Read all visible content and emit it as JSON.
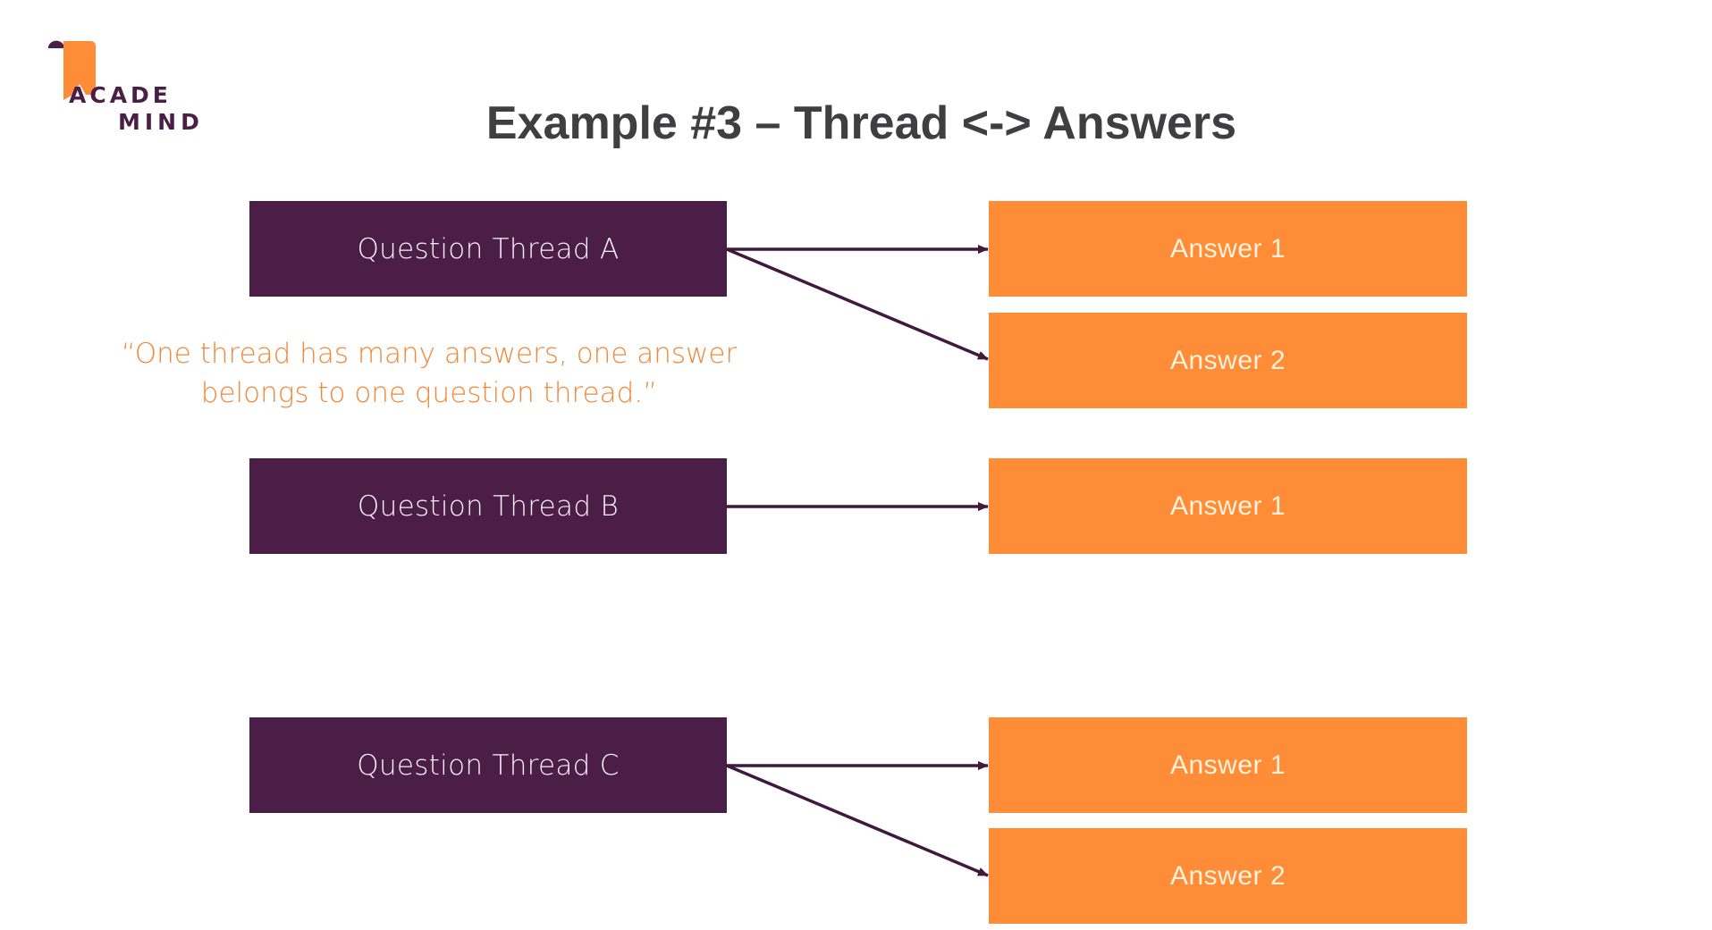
{
  "logo": {
    "line1": "ACADE",
    "line2": "MIND",
    "colors": {
      "purple": "#4a1f47",
      "orange": "#ff8c36"
    }
  },
  "title": "Example #3 – Thread <-> Answers",
  "quote": {
    "line1": "“One thread has many answers, one answer",
    "line2": "belongs to one question thread.”"
  },
  "threads": [
    {
      "label": "Question Thread A",
      "answers": [
        "Answer 1",
        "Answer 2"
      ]
    },
    {
      "label": "Question Thread B",
      "answers": [
        "Answer 1"
      ]
    },
    {
      "label": "Question Thread C",
      "answers": [
        "Answer 1",
        "Answer 2"
      ]
    }
  ],
  "colors": {
    "thread_box": "#4b1e48",
    "answer_box": "#ff8c36",
    "arrow": "#3f1a3d",
    "title_text": "#3f3f41",
    "quote_text": "#f0883a"
  }
}
